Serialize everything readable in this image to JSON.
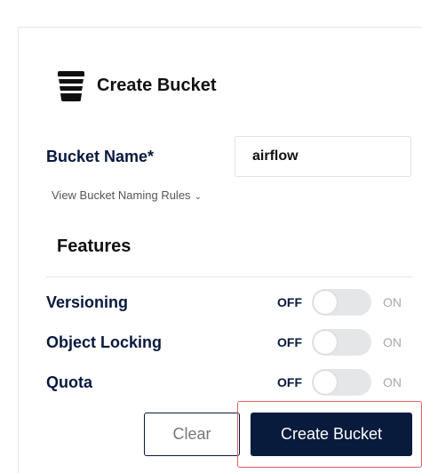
{
  "header": {
    "icon": "bucket-icon",
    "title": "Create Bucket"
  },
  "form": {
    "bucket_name_label": "Bucket Name*",
    "bucket_name_value": "airflow",
    "naming_rules_link": "View Bucket Naming Rules"
  },
  "features": {
    "title": "Features",
    "items": [
      {
        "label": "Versioning",
        "off_text": "OFF",
        "on_text": "ON",
        "enabled": false
      },
      {
        "label": "Object Locking",
        "off_text": "OFF",
        "on_text": "ON",
        "enabled": false
      },
      {
        "label": "Quota",
        "off_text": "OFF",
        "on_text": "ON",
        "enabled": false
      }
    ]
  },
  "actions": {
    "clear_label": "Clear",
    "create_label": "Create Bucket"
  },
  "colors": {
    "primary": "#081b3c",
    "label": "#07193e",
    "highlight": "#e06060"
  }
}
